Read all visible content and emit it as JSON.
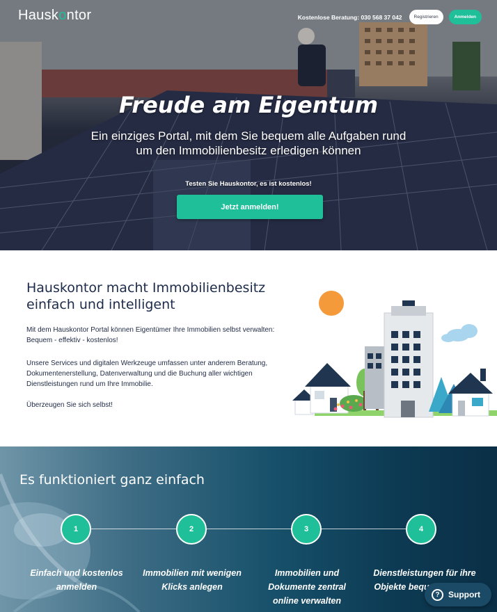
{
  "header": {
    "logo_text_a": "Hausk",
    "logo_text_o": "o",
    "logo_text_b": "ntor",
    "hotline": "Kostenlose Beratung: 030 568 37 042",
    "register_label": "Registrieren",
    "login_label": "Anmelden"
  },
  "hero": {
    "title": "Freude am Eigentum",
    "subtitle": "Ein einziges Portal, mit dem Sie bequem alle Aufgaben rund um den Immobilienbesitz erledigen können",
    "cta_text": "Testen Sie Hauskontor, es ist kostenlos!",
    "cta_button": "Jetzt anmelden!"
  },
  "intro": {
    "heading": "Hauskontor macht Immobilienbesitz einfach und intelligent",
    "paragraph1": "Mit dem Hauskontor Portal können Eigentümer Ihre Immobilien selbst verwalten: Bequem - effektiv - kostenlos!",
    "paragraph2": "Unsere Services und digitalen Werkzeuge umfassen unter anderem Beratung, Dokumentenerstellung, Datenverwaltung und die Buchung aller wichtigen Dienstleistungen rund um Ihre Immobilie.",
    "paragraph3": "Überzeugen Sie sich selbst!"
  },
  "steps": {
    "heading": "Es funktioniert ganz einfach",
    "items": [
      {
        "number": "1",
        "label": "Einfach und kostenlos anmelden"
      },
      {
        "number": "2",
        "label": "Immobilien mit wenigen Klicks anlegen"
      },
      {
        "number": "3",
        "label": "Immobilien und Dokumente zentral online verwalten"
      },
      {
        "number": "4",
        "label": "Dienstleistungen für ihre Objekte bequem buchen"
      }
    ]
  },
  "support": {
    "label": "Support",
    "icon": "question-icon"
  },
  "colors": {
    "accent": "#1fbf9a",
    "navy": "#1c2b4a",
    "steps_bg": "#17506a"
  }
}
